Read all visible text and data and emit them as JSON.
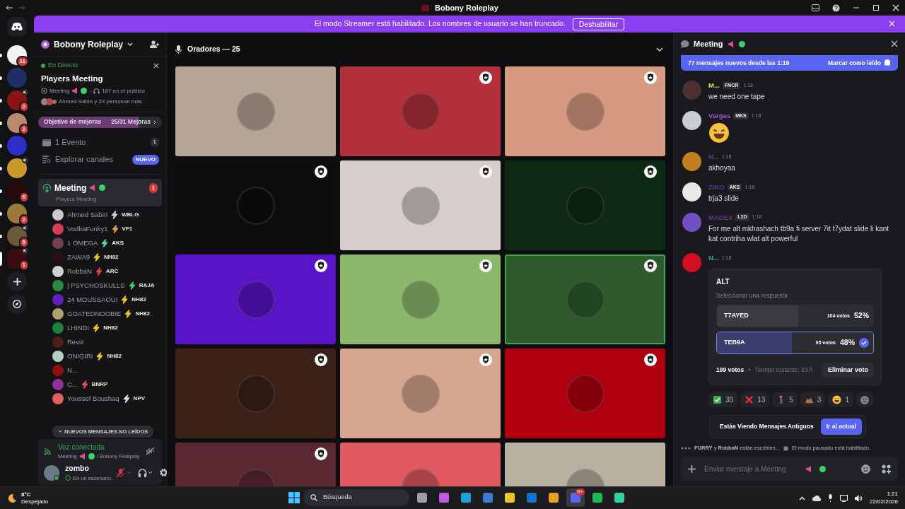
{
  "title_bar": {
    "title": "Bobony Roleplay"
  },
  "banner": {
    "text": "El modo Streamer está habilitado. Los nombres de usuario se han truncado.",
    "button": "Deshabilitar"
  },
  "servers": [
    {
      "color": "#f2f2f2",
      "badge": "11",
      "voice": false,
      "unread": true,
      "selected": false
    },
    {
      "color": "#1d2f66",
      "voice": false,
      "unread": true,
      "selected": false
    },
    {
      "color": "#8a1414",
      "badge": "2",
      "voice": true,
      "unread": true,
      "selected": false
    },
    {
      "color": "#b98a6e",
      "badge": "2",
      "voice": false,
      "unread": true,
      "selected": false
    },
    {
      "color": "#2e2fc9",
      "voice": false,
      "unread": true,
      "selected": false
    },
    {
      "color": "#c9992a",
      "voice": true,
      "unread": true,
      "selected": false
    },
    {
      "color": "#2a0a0c",
      "badge": "6",
      "voice": false,
      "unread": true,
      "selected": false
    },
    {
      "color": "#9a7a34",
      "badge": "2",
      "voice": false,
      "unread": true,
      "selected": false
    },
    {
      "color": "#6b5a3a",
      "badge": "5",
      "voice": true,
      "unread": true,
      "selected": false
    },
    {
      "color": "#3a0c14",
      "badge": "1",
      "voice": true,
      "unread": false,
      "selected": true
    }
  ],
  "sidebar": {
    "server_name": "Bobony Roleplay",
    "live": {
      "label": "En Directo",
      "title": "Players Meeting",
      "channel": "Meeting",
      "separator": "-",
      "audience": "187 en el público",
      "speakers": "Ahmed Sabiri y 24 personas más"
    },
    "boost": {
      "label": "Objetivo de mejoras",
      "progress": "25/31 Mejoras",
      "level": 0.806
    },
    "events": {
      "label": "1 Evento",
      "count": "1"
    },
    "browse": {
      "label": "Explorar canales",
      "badge": "NUEVO"
    },
    "channel": {
      "name": "Meeting",
      "subtitle": "Players Meeting",
      "badge": "1",
      "selected": true
    },
    "members": [
      {
        "name": "Ahmed Sabiri",
        "tag": "WBLG",
        "color": "#cfcfcf"
      },
      {
        "name": "VodkaFunky1",
        "tag": "VF1",
        "color": "#f0a030"
      },
      {
        "name": "1 OMEGA",
        "tag": "AKS",
        "color": "#5fd0a0"
      },
      {
        "name": "ZAWA9",
        "tag": "NH82",
        "color": "#f5c518"
      },
      {
        "name": "RobbaN",
        "tag": "ARC",
        "color": "#e04050"
      },
      {
        "name": "| PSYCHOSKULLS",
        "tag": "RAJA",
        "color": "#3bd15c"
      },
      {
        "name": "24 MOUSSAOUI",
        "tag": "NH82",
        "color": "#f5c518"
      },
      {
        "name": "GOATEDNOOBIE",
        "tag": "NH82",
        "color": "#f5c518"
      },
      {
        "name": "LHINDI",
        "tag": "NH82",
        "color": "#f5c518"
      },
      {
        "name": "Reviz"
      },
      {
        "name": "ONIGIRI",
        "tag": "NH82",
        "color": "#f5c518"
      },
      {
        "name": "N..."
      },
      {
        "name": "C...",
        "tag": "BNRP",
        "color": "#e05060"
      },
      {
        "name": "Youssef Boushaq",
        "tag": "NPV",
        "color": "#dddddd"
      }
    ],
    "unread_pill": "NUEVOS MENSAJES NO LEÍDOS",
    "voice": {
      "status": "Voz conectada",
      "channel": "Meeting",
      "server": "/ Bobony Roleplay"
    },
    "user": {
      "name": "zombo",
      "status": "En un escenario",
      "muted": true
    }
  },
  "stage": {
    "title": "Oradores — 25",
    "tiles": [
      {
        "color": "#b5a596",
        "moderator": false,
        "speaking": false
      },
      {
        "color": "#b3303a",
        "moderator": true,
        "speaking": false
      },
      {
        "color": "#d69a80",
        "moderator": true,
        "speaking": false
      },
      {
        "color": "#0d0d0e",
        "moderator": true,
        "speaking": false
      },
      {
        "color": "#d6cecb",
        "moderator": true,
        "speaking": false
      },
      {
        "color": "#0f2a14",
        "moderator": true,
        "speaking": false
      },
      {
        "color": "#5a14c8",
        "moderator": true,
        "speaking": false
      },
      {
        "color": "#8cb86c",
        "moderator": true,
        "speaking": false
      },
      {
        "color": "#2f5a2c",
        "moderator": true,
        "speaking": true
      },
      {
        "color": "#3b2118",
        "moderator": true,
        "speaking": false
      },
      {
        "color": "#d6a690",
        "moderator": true,
        "speaking": false
      },
      {
        "color": "#b0000f",
        "moderator": true,
        "speaking": false
      },
      {
        "color": "#5a2830",
        "moderator": true,
        "speaking": false
      },
      {
        "color": "#e05860",
        "moderator": false,
        "speaking": false
      },
      {
        "color": "#b8b0a0",
        "moderator": false,
        "speaking": false
      }
    ]
  },
  "chat": {
    "channel": "Meeting",
    "new_messages": {
      "text": "77 mensajes nuevos desde las 1:19",
      "action": "Marcar como leído"
    },
    "messages": [
      {
        "kind": "text",
        "author": "M...",
        "color": "#d4e157",
        "tag": "FNCR",
        "time": "1:18",
        "text": "we need one tape"
      },
      {
        "kind": "emoji",
        "author": "Vargas",
        "color": "#9b59d6",
        "tag": "MKS",
        "time": "1:18"
      },
      {
        "kind": "text",
        "author": "N...",
        "color": "#5d3b86",
        "time": "1:18",
        "text": "akhoyaa"
      },
      {
        "kind": "text",
        "author": "ZIKO",
        "color": "#5d3b86",
        "tag": "AKS",
        "time": "1:18",
        "text": "trja3 slide"
      },
      {
        "kind": "text",
        "author": "MADEX",
        "color": "#5d3b86",
        "tag": "L2D",
        "time": "1:18",
        "text": "For me alt mkhashach tb9a fi server 7it t7ydat slide li kant kat contriha wlat alt powerful"
      },
      {
        "kind": "poll",
        "author": "N...",
        "color": "#3aa0a0",
        "time": "1:18",
        "poll": {
          "question": "ALT",
          "hint": "Seleccionar una respuesta",
          "options": [
            {
              "label": "T7AYED",
              "votes": "104 votos",
              "percent": "52%",
              "level": 0.52,
              "selected": false
            },
            {
              "label": "TEB9A",
              "votes": "95 votos",
              "percent": "48%",
              "level": 0.48,
              "selected": true
            }
          ],
          "total": "199 votos",
          "separator": "•",
          "remaining": "Tiempo restante: 23 h",
          "action": "Eliminar voto"
        },
        "reactions": [
          {
            "kind": "check",
            "count": "30"
          },
          {
            "kind": "cross",
            "count": "13"
          },
          {
            "kind": "person",
            "count": "5"
          },
          {
            "kind": "hands",
            "count": "3"
          },
          {
            "kind": "laugh",
            "count": "1"
          }
        ]
      }
    ],
    "toast": {
      "text": "Estás Viendo Mensajes Antiguos",
      "action": "Ir al actual"
    },
    "typing": "**FURRY** y **RobbaN** están escribien...",
    "paused": "El modo pausado está habilitado.",
    "input": {
      "placeholder": "Enviar mensaje a Meeting"
    }
  },
  "taskbar": {
    "weather": {
      "temp": "8°C",
      "desc": "Despejado"
    },
    "search": "Búsqueda",
    "apps": [
      {
        "color": "#9aa0a6",
        "active": false
      },
      {
        "color": "#c05ae0",
        "active": false
      },
      {
        "color": "#1ea0d8",
        "active": false
      },
      {
        "color": "#3a7bd5",
        "active": false
      },
      {
        "color": "#f2c230",
        "active": false
      },
      {
        "color": "#1a6fd0",
        "active": false
      },
      {
        "color": "#e8a020",
        "active": false
      },
      {
        "color": "#5865f2",
        "active": true,
        "badge": "9+"
      },
      {
        "color": "#1db954",
        "active": false
      },
      {
        "color": "#2bd4a0",
        "active": false
      }
    ],
    "time": "1:21",
    "date": "22/02/2026"
  }
}
